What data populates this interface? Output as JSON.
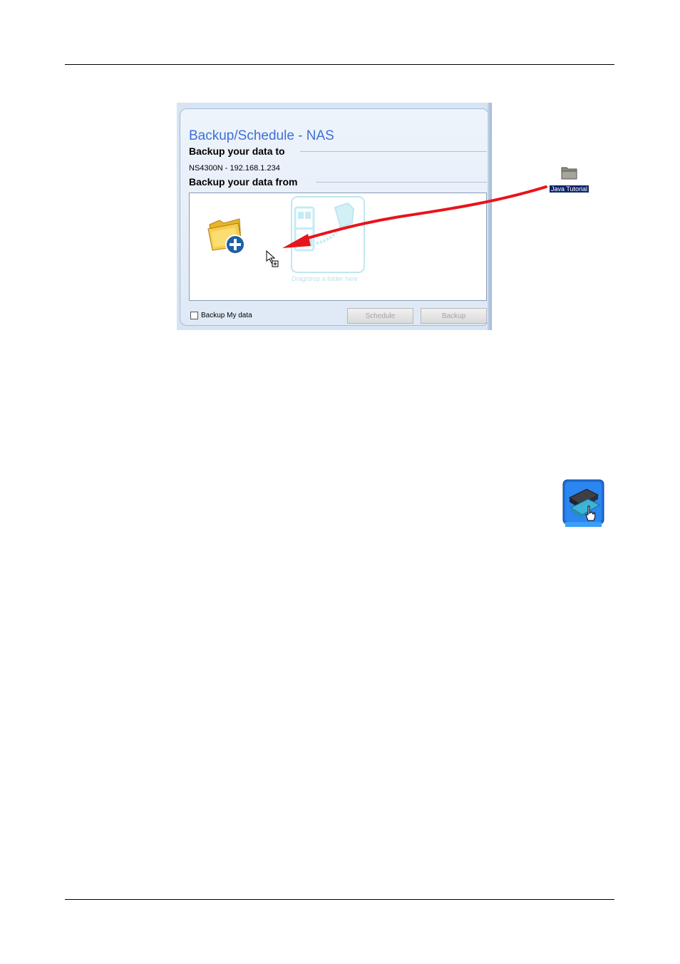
{
  "panel": {
    "title": "Backup/Schedule - NAS",
    "backup_to_heading": "Backup your data to",
    "target_device": "NS4300N - 192.168.1.234",
    "backup_from_heading": "Backup your data from",
    "drop_hint": "Drag/drop a folder here",
    "checkbox_label": "Backup My data",
    "checkbox_checked": false,
    "schedule_button": "Schedule",
    "backup_button": "Backup"
  },
  "desktop_folder": {
    "label": "Java Tutorial",
    "icon": "folder-icon"
  },
  "annotation": {
    "arrow_color": "#e8141c",
    "icon": "drag-arrow"
  },
  "app_icon": {
    "icon": "backup-app-icon"
  },
  "colors": {
    "title": "#3e6fd6",
    "panel_background": "#d7e4f3",
    "folder_label_background": "#0a246a"
  }
}
